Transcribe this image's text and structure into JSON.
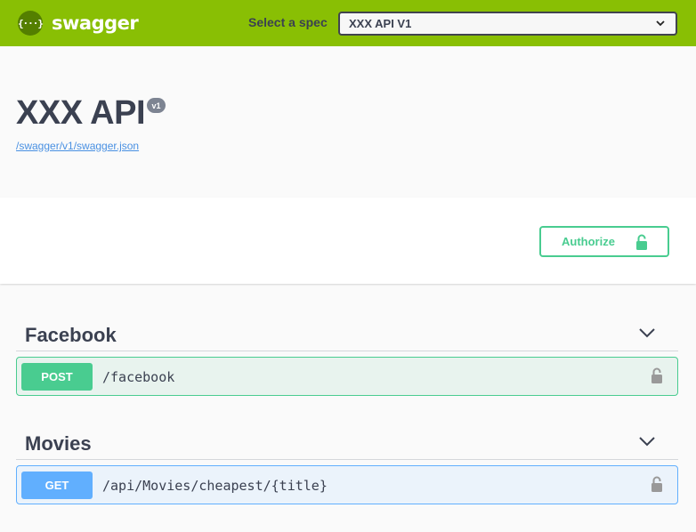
{
  "topbar": {
    "logo_glyph": "{···}",
    "logo_text": "swagger",
    "spec_label": "Select a spec",
    "spec_selected": "XXX API V1",
    "background": "#89bf04"
  },
  "info": {
    "title": "XXX API",
    "version": "v1",
    "spec_url": "/swagger/v1/swagger.json"
  },
  "auth": {
    "authorize_label": "Authorize",
    "accent": "#49cc90",
    "icon": "unlocked-padlock-icon"
  },
  "tags": [
    {
      "name": "Facebook",
      "operations": [
        {
          "method": "POST",
          "path": "/facebook",
          "color": "#49cc90"
        }
      ]
    },
    {
      "name": "Movies",
      "operations": [
        {
          "method": "GET",
          "path": "/api/Movies/cheapest/{title}",
          "color": "#61affe"
        }
      ]
    }
  ]
}
